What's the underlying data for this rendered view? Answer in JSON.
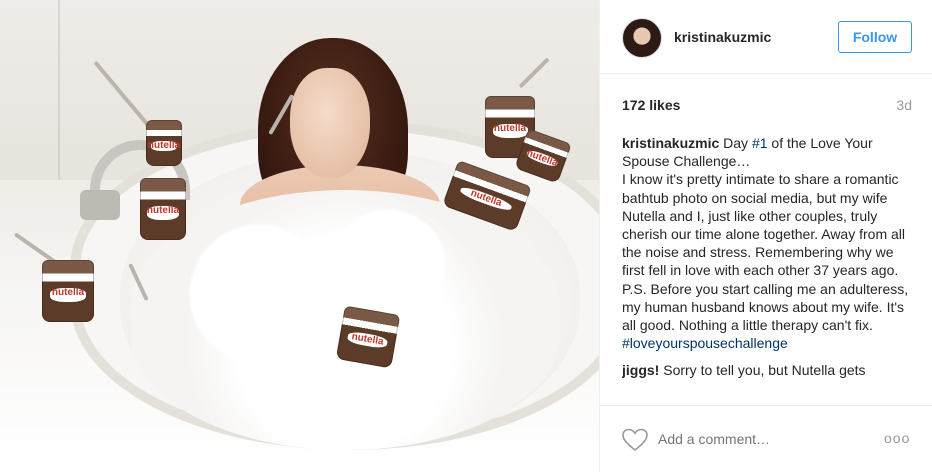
{
  "post": {
    "username": "kristinakuzmic",
    "follow_label": "Follow",
    "likes": "172 likes",
    "time_ago": "3d",
    "image_jar_label": "nutella"
  },
  "caption": {
    "author": "kristinakuzmic",
    "text_before_tag": " Day ",
    "tag1": "#1",
    "text_after_tag": " of the Love Your Spouse Challenge…",
    "line2": "I know it's pretty intimate to share a romantic bathtub photo on social media, but my wife Nutella and I, just like other couples, truly cherish our time alone together. Away from all the noise and stress. Remembering why we first fell in love with each other 37 years ago.",
    "line3": "P.S. Before you start calling me an adulteress, my human husband knows about my wife. It's all good. Nothing a little therapy can't fix.",
    "hashtag": "#loveyourspousechallenge"
  },
  "comment2": {
    "author": "jiggs!",
    "text": " Sorry to tell you, but Nutella gets"
  },
  "footer": {
    "add_comment_placeholder": "Add a comment…",
    "more_label": "ooo"
  },
  "colors": {
    "accent": "#3897f0",
    "hashtag": "#003569",
    "muted": "#999999"
  },
  "icons": [
    "heart-icon",
    "more-options-icon"
  ]
}
